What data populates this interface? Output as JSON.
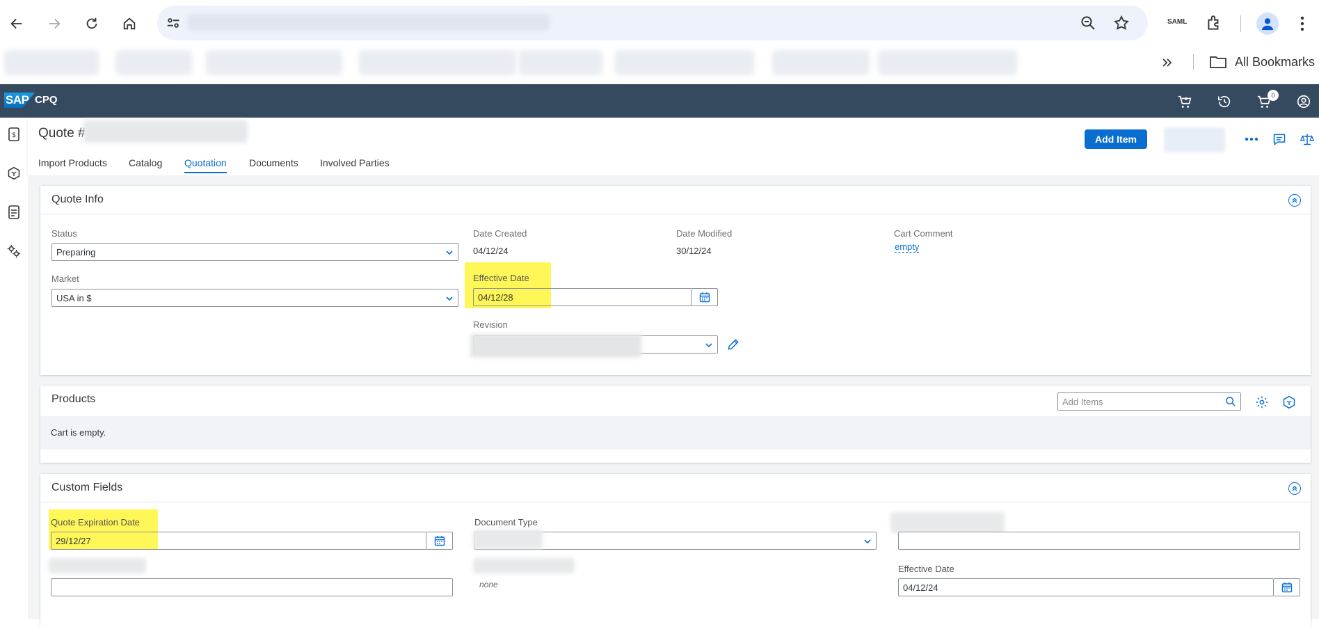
{
  "browser": {
    "all_bookmarks_label": "All Bookmarks",
    "extension_badge": "SAML"
  },
  "sap": {
    "logo": "SAP",
    "app_name": "CPQ",
    "cart_count": "0"
  },
  "header": {
    "title": "Quote #",
    "add_item_label": "Add Item",
    "tabs": [
      {
        "label": "Import Products"
      },
      {
        "label": "Catalog"
      },
      {
        "label": "Quotation"
      },
      {
        "label": "Documents"
      },
      {
        "label": "Involved Parties"
      }
    ],
    "active_tab": "Quotation"
  },
  "quote_info": {
    "title": "Quote Info",
    "status_label": "Status",
    "status_value": "Preparing",
    "market_label": "Market",
    "market_value": "USA in $",
    "date_created_label": "Date Created",
    "date_created_value": "04/12/24",
    "date_modified_label": "Date Modified",
    "date_modified_value": "30/12/24",
    "cart_comment_label": "Cart Comment",
    "cart_comment_value": "empty",
    "effective_date_label": "Effective Date",
    "effective_date_value": "04/12/28",
    "revision_label": "Revision"
  },
  "products": {
    "title": "Products",
    "search_placeholder": "Add Items",
    "empty_text": "Cart is empty."
  },
  "custom_fields": {
    "title": "Custom Fields",
    "expiration_label": "Quote Expiration Date",
    "expiration_value": "29/12/27",
    "document_type_label": "Document Type",
    "none_text": "none",
    "effective_date_label": "Effective Date",
    "effective_date_value": "04/12/24"
  },
  "colors": {
    "sap_header": "#354a5f",
    "accent": "#0a6ed1",
    "highlight": "#fff43a"
  }
}
